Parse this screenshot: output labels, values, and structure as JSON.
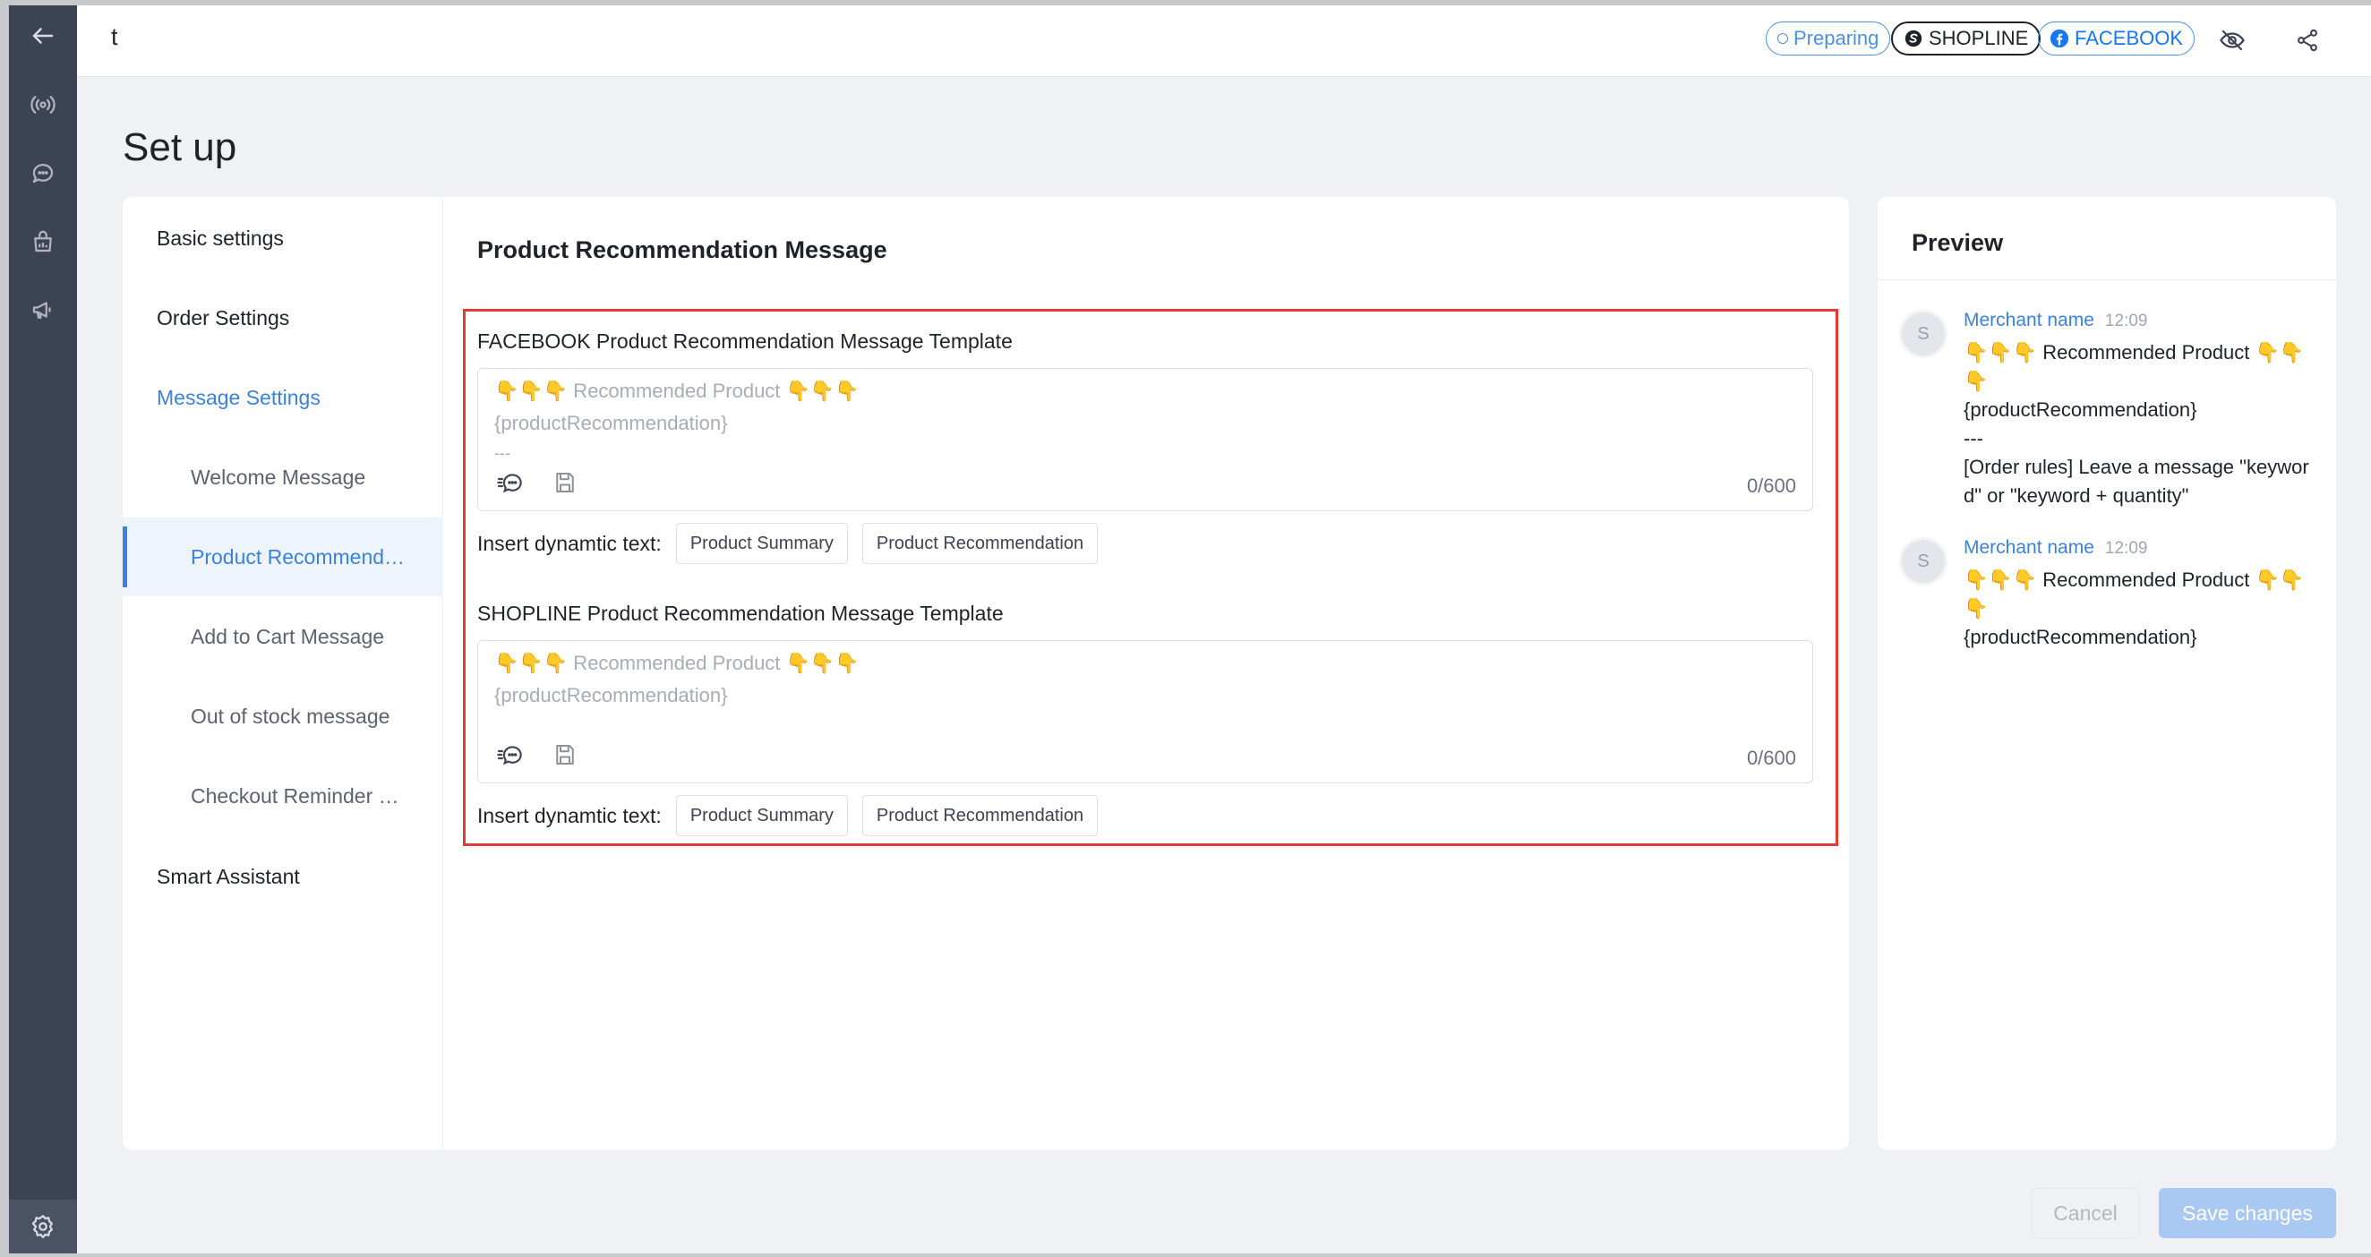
{
  "header": {
    "title": "t",
    "status_tag": "Preparing",
    "platform_tags": [
      "SHOPLINE",
      "FACEBOOK"
    ]
  },
  "page": {
    "title": "Set up"
  },
  "nav": {
    "items": [
      {
        "label": "Basic settings"
      },
      {
        "label": "Order Settings"
      },
      {
        "label": "Message Settings"
      },
      {
        "label": "Welcome Message"
      },
      {
        "label": "Product Recommendation Message"
      },
      {
        "label": "Add to Cart Message"
      },
      {
        "label": "Out of stock message"
      },
      {
        "label": "Checkout Reminder Message"
      },
      {
        "label": "Smart Assistant"
      }
    ]
  },
  "main": {
    "section_title": "Product Recommendation Message",
    "templates": [
      {
        "title": "FACEBOOK Product Recommendation Message Template",
        "placeholder_line1_emoji_left": "👇👇👇",
        "placeholder_line1_text": " Recommended Product ",
        "placeholder_line1_emoji_right": "👇👇👇",
        "placeholder_line2": "{productRecommendation}",
        "placeholder_line3": "---",
        "count": "0/600",
        "insert_label": "Insert dynamtic text:",
        "chips": [
          "Product Summary",
          "Product Recommendation"
        ]
      },
      {
        "title": "SHOPLINE Product Recommendation Message Template",
        "placeholder_line1_emoji_left": "👇👇👇",
        "placeholder_line1_text": " Recommended Product ",
        "placeholder_line1_emoji_right": "👇👇👇",
        "placeholder_line2": "{productRecommendation}",
        "count": "0/600",
        "insert_label": "Insert dynamtic text:",
        "chips": [
          "Product Summary",
          "Product Recommendation"
        ]
      }
    ]
  },
  "preview": {
    "title": "Preview",
    "messages": [
      {
        "avatar": "S",
        "name": "Merchant name",
        "time": "12:09",
        "body": "👇👇👇 Recommended Product 👇👇👇\n{productRecommendation}\n---\n[Order rules] Leave a message \"keyword\" or \"keyword + quantity\""
      },
      {
        "avatar": "S",
        "name": "Merchant name",
        "time": "12:09",
        "body": "👇👇👇 Recommended Product 👇👇👇\n{productRecommendation}"
      }
    ]
  },
  "footer": {
    "cancel_label": "Cancel",
    "save_label": "Save changes"
  },
  "colors": {
    "accent": "#3b82e0",
    "rail": "#3c4352",
    "highlight": "#e53935",
    "save_disabled": "#a9c8f2"
  },
  "icons": {
    "rail": [
      "back-arrow-icon",
      "broadcast-icon",
      "chat-icon",
      "store-icon",
      "megaphone-icon",
      "gear-icon"
    ],
    "top": [
      "eye-off-icon",
      "share-icon"
    ],
    "editor": [
      "quick-reply-icon",
      "save-template-icon"
    ]
  }
}
